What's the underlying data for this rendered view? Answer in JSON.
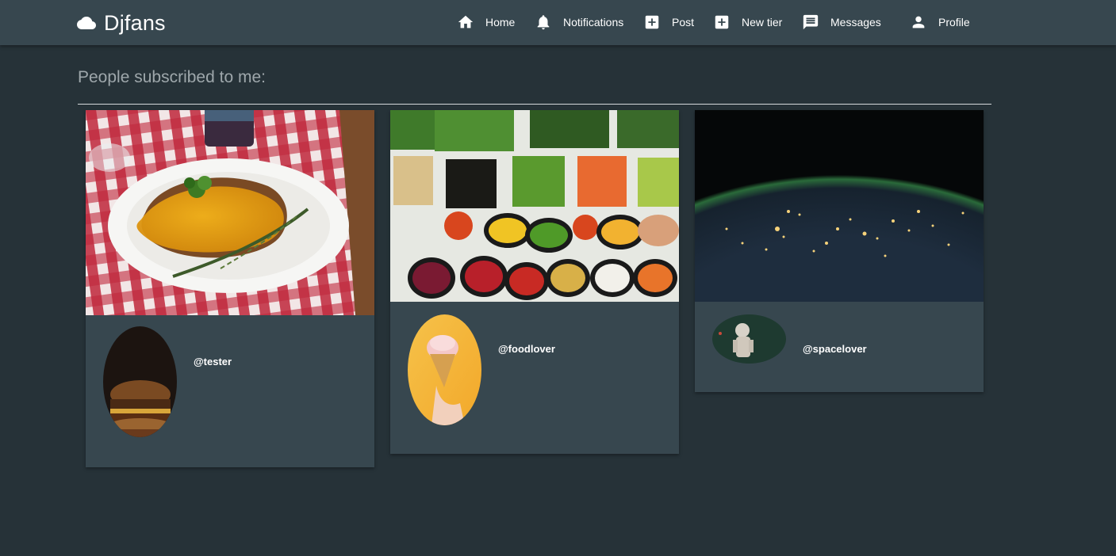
{
  "app": {
    "name": "Djfans",
    "logo_icon": "cloud-icon"
  },
  "nav": {
    "items": [
      {
        "label": "Home",
        "icon": "home-icon"
      },
      {
        "label": "Notifications",
        "icon": "bell-icon"
      },
      {
        "label": "Post",
        "icon": "add-box-icon"
      },
      {
        "label": "New tier",
        "icon": "add-box-icon"
      },
      {
        "label": "Messages",
        "icon": "message-icon"
      },
      {
        "label": "Profile",
        "icon": "person-icon"
      }
    ]
  },
  "main": {
    "title": "People subscribed to me:",
    "subscribers": [
      {
        "username": "@tester",
        "cover": "plated-food-on-checkered-cloth",
        "avatar": "burger"
      },
      {
        "username": "@foodlover",
        "cover": "salad-bar-vegetables",
        "avatar": "ice-cream-cone"
      },
      {
        "username": "@spacelover",
        "cover": "earth-at-night",
        "avatar": "astronaut"
      }
    ]
  },
  "colors": {
    "background": "#263238",
    "navbar": "#37474f",
    "card": "#37474f",
    "muted_text": "#9ea7ab",
    "text": "#ffffff"
  }
}
